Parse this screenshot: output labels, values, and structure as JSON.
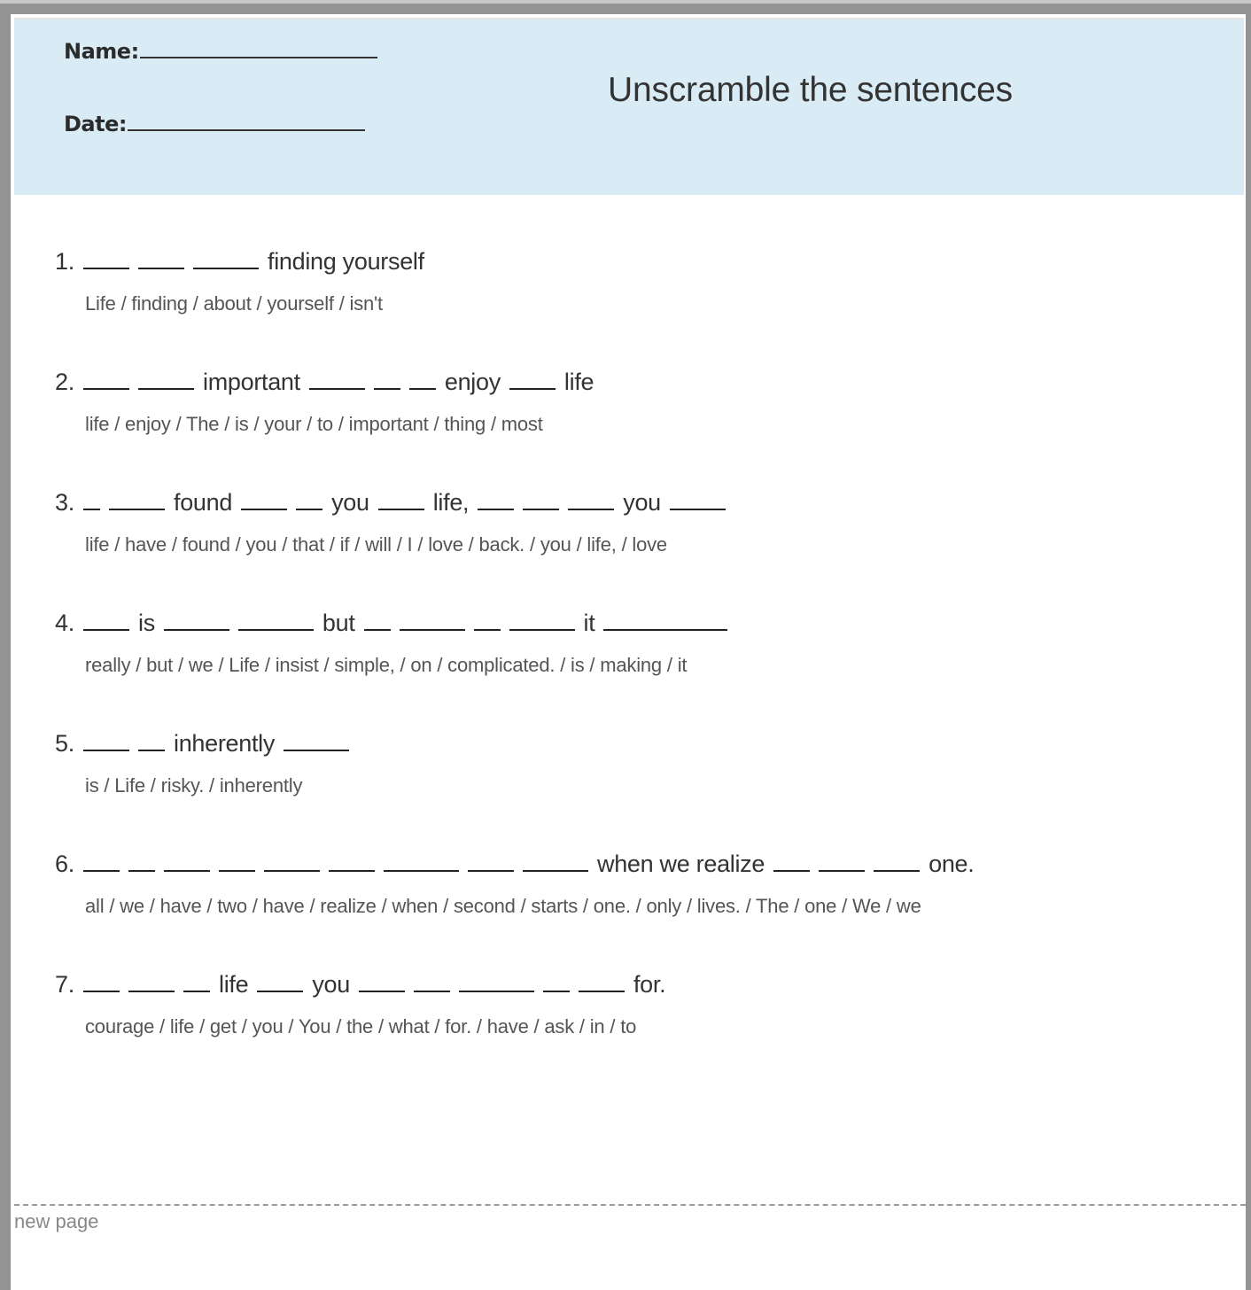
{
  "header": {
    "name_label": "Name:",
    "date_label": "Date:",
    "title": "Unscramble the sentences",
    "background_color": "#d9ecf5"
  },
  "exercises": [
    {
      "number": "1.",
      "sentence": [
        {
          "blank": 4
        },
        {
          "blank": 4
        },
        {
          "blank": 6
        },
        {
          "text": "finding yourself"
        }
      ],
      "words": "Life / finding / about / yourself / isn't"
    },
    {
      "number": "2.",
      "sentence": [
        {
          "blank": 4
        },
        {
          "blank": 5
        },
        {
          "text": "important"
        },
        {
          "blank": 5
        },
        {
          "blank": 2
        },
        {
          "blank": 2
        },
        {
          "text": "enjoy"
        },
        {
          "blank": 4
        },
        {
          "text": "life"
        }
      ],
      "words": "life / enjoy / The / is / your / to / important / thing / most"
    },
    {
      "number": "3.",
      "sentence": [
        {
          "blank": 1
        },
        {
          "blank": 5
        },
        {
          "text": "found"
        },
        {
          "blank": 4
        },
        {
          "blank": 2
        },
        {
          "text": "you"
        },
        {
          "blank": 4
        },
        {
          "text": "life,"
        },
        {
          "blank": 3
        },
        {
          "blank": 3
        },
        {
          "blank": 4
        },
        {
          "text": "you"
        },
        {
          "blank": 5
        }
      ],
      "words": "life / have / found / you / that / if / will / I / love / back. / you / life, / love"
    },
    {
      "number": "4.",
      "sentence": [
        {
          "blank": 4
        },
        {
          "text": "is"
        },
        {
          "blank": 6
        },
        {
          "blank": 7
        },
        {
          "text": "but"
        },
        {
          "blank": 2
        },
        {
          "blank": 6
        },
        {
          "blank": 2
        },
        {
          "blank": 6
        },
        {
          "text": "it"
        },
        {
          "blank": 12
        }
      ],
      "words": "really / but / we / Life / insist / simple, / on / complicated. / is / making / it"
    },
    {
      "number": "5.",
      "sentence": [
        {
          "blank": 4
        },
        {
          "blank": 2
        },
        {
          "text": "inherently"
        },
        {
          "blank": 6
        }
      ],
      "words": "is / Life / risky. / inherently"
    },
    {
      "number": "6.",
      "sentence": [
        {
          "blank": 3
        },
        {
          "blank": 2
        },
        {
          "blank": 4
        },
        {
          "blank": 3
        },
        {
          "blank": 5
        },
        {
          "blank": 4
        },
        {
          "blank": 7
        },
        {
          "blank": 4
        },
        {
          "blank": 6
        },
        {
          "text": "when we realize"
        },
        {
          "blank": 3
        },
        {
          "blank": 4
        },
        {
          "blank": 4
        },
        {
          "text": "one."
        }
      ],
      "words": "all / we / have / two / have / realize / when / second / starts / one. / only / lives. / The / one / We / we"
    },
    {
      "number": "7.",
      "sentence": [
        {
          "blank": 3
        },
        {
          "blank": 4
        },
        {
          "blank": 2
        },
        {
          "text": "life"
        },
        {
          "blank": 4
        },
        {
          "text": "you"
        },
        {
          "blank": 4
        },
        {
          "blank": 3
        },
        {
          "blank": 7
        },
        {
          "blank": 2
        },
        {
          "blank": 4
        },
        {
          "text": "for."
        }
      ],
      "words": "courage / life / get / you / You / the / what / for. / have / ask / in / to"
    }
  ],
  "footer": {
    "page_break_label": "new page"
  }
}
